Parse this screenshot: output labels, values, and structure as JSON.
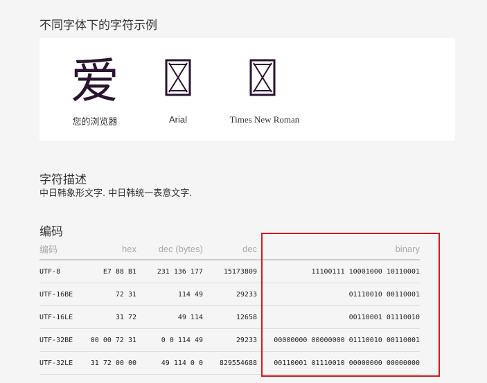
{
  "samples": {
    "title": "不同字体下的字符示例",
    "items": [
      {
        "glyph": "爱",
        "label": "您的浏览器"
      },
      {
        "glyph": "",
        "label": "Arial"
      },
      {
        "glyph": "",
        "label": "Times New Roman"
      }
    ]
  },
  "description": {
    "title": "字符描述",
    "text": "中日韩象形文字. 中日韩统一表意文字."
  },
  "encoding": {
    "title": "编码",
    "headers": [
      "编码",
      "hex",
      "dec (bytes)",
      "dec",
      "binary"
    ],
    "rows": [
      [
        "UTF-8",
        "E7 88 B1",
        "231 136 177",
        "15173809",
        "11100111 10001000 10110001"
      ],
      [
        "UTF-16BE",
        "72 31",
        "114 49",
        "29233",
        "01110010 00110001"
      ],
      [
        "UTF-16LE",
        "31 72",
        "49 114",
        "12658",
        "00110001 01110010"
      ],
      [
        "UTF-32BE",
        "00 00 72 31",
        "0 0 114 49",
        "29233",
        "00000000 00000000 01110010 00110001"
      ],
      [
        "UTF-32LE",
        "31 72 00 00",
        "49 114 0 0",
        "829554688",
        "00110001 01110010 00000000 00000000"
      ]
    ]
  },
  "colors": {
    "glyph": "#2a1330",
    "highlight": "#d6171b"
  }
}
